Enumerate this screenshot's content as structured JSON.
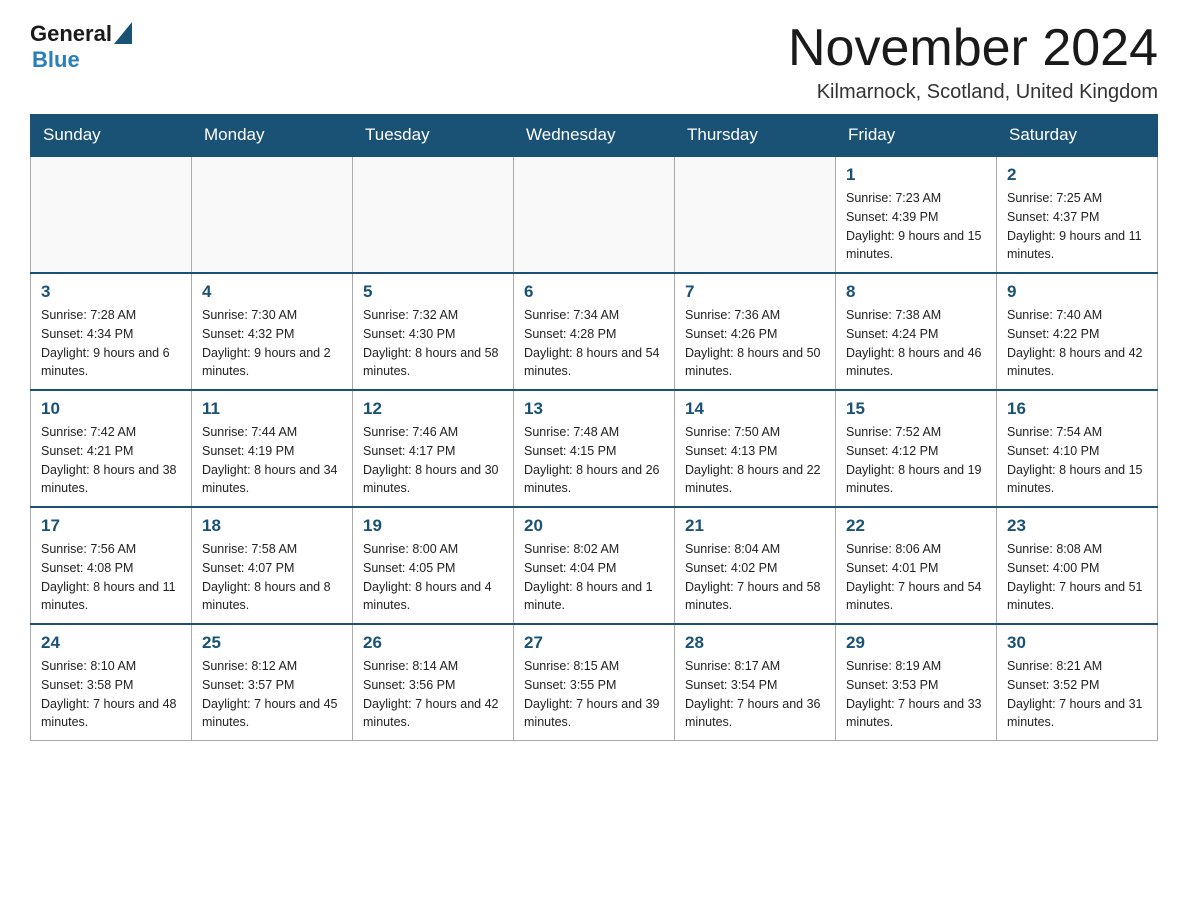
{
  "header": {
    "logo_general": "General",
    "logo_blue": "Blue",
    "month_title": "November 2024",
    "location": "Kilmarnock, Scotland, United Kingdom"
  },
  "weekdays": [
    "Sunday",
    "Monday",
    "Tuesday",
    "Wednesday",
    "Thursday",
    "Friday",
    "Saturday"
  ],
  "weeks": [
    [
      {
        "day": "",
        "info": ""
      },
      {
        "day": "",
        "info": ""
      },
      {
        "day": "",
        "info": ""
      },
      {
        "day": "",
        "info": ""
      },
      {
        "day": "",
        "info": ""
      },
      {
        "day": "1",
        "info": "Sunrise: 7:23 AM\nSunset: 4:39 PM\nDaylight: 9 hours and 15 minutes."
      },
      {
        "day": "2",
        "info": "Sunrise: 7:25 AM\nSunset: 4:37 PM\nDaylight: 9 hours and 11 minutes."
      }
    ],
    [
      {
        "day": "3",
        "info": "Sunrise: 7:28 AM\nSunset: 4:34 PM\nDaylight: 9 hours and 6 minutes."
      },
      {
        "day": "4",
        "info": "Sunrise: 7:30 AM\nSunset: 4:32 PM\nDaylight: 9 hours and 2 minutes."
      },
      {
        "day": "5",
        "info": "Sunrise: 7:32 AM\nSunset: 4:30 PM\nDaylight: 8 hours and 58 minutes."
      },
      {
        "day": "6",
        "info": "Sunrise: 7:34 AM\nSunset: 4:28 PM\nDaylight: 8 hours and 54 minutes."
      },
      {
        "day": "7",
        "info": "Sunrise: 7:36 AM\nSunset: 4:26 PM\nDaylight: 8 hours and 50 minutes."
      },
      {
        "day": "8",
        "info": "Sunrise: 7:38 AM\nSunset: 4:24 PM\nDaylight: 8 hours and 46 minutes."
      },
      {
        "day": "9",
        "info": "Sunrise: 7:40 AM\nSunset: 4:22 PM\nDaylight: 8 hours and 42 minutes."
      }
    ],
    [
      {
        "day": "10",
        "info": "Sunrise: 7:42 AM\nSunset: 4:21 PM\nDaylight: 8 hours and 38 minutes."
      },
      {
        "day": "11",
        "info": "Sunrise: 7:44 AM\nSunset: 4:19 PM\nDaylight: 8 hours and 34 minutes."
      },
      {
        "day": "12",
        "info": "Sunrise: 7:46 AM\nSunset: 4:17 PM\nDaylight: 8 hours and 30 minutes."
      },
      {
        "day": "13",
        "info": "Sunrise: 7:48 AM\nSunset: 4:15 PM\nDaylight: 8 hours and 26 minutes."
      },
      {
        "day": "14",
        "info": "Sunrise: 7:50 AM\nSunset: 4:13 PM\nDaylight: 8 hours and 22 minutes."
      },
      {
        "day": "15",
        "info": "Sunrise: 7:52 AM\nSunset: 4:12 PM\nDaylight: 8 hours and 19 minutes."
      },
      {
        "day": "16",
        "info": "Sunrise: 7:54 AM\nSunset: 4:10 PM\nDaylight: 8 hours and 15 minutes."
      }
    ],
    [
      {
        "day": "17",
        "info": "Sunrise: 7:56 AM\nSunset: 4:08 PM\nDaylight: 8 hours and 11 minutes."
      },
      {
        "day": "18",
        "info": "Sunrise: 7:58 AM\nSunset: 4:07 PM\nDaylight: 8 hours and 8 minutes."
      },
      {
        "day": "19",
        "info": "Sunrise: 8:00 AM\nSunset: 4:05 PM\nDaylight: 8 hours and 4 minutes."
      },
      {
        "day": "20",
        "info": "Sunrise: 8:02 AM\nSunset: 4:04 PM\nDaylight: 8 hours and 1 minute."
      },
      {
        "day": "21",
        "info": "Sunrise: 8:04 AM\nSunset: 4:02 PM\nDaylight: 7 hours and 58 minutes."
      },
      {
        "day": "22",
        "info": "Sunrise: 8:06 AM\nSunset: 4:01 PM\nDaylight: 7 hours and 54 minutes."
      },
      {
        "day": "23",
        "info": "Sunrise: 8:08 AM\nSunset: 4:00 PM\nDaylight: 7 hours and 51 minutes."
      }
    ],
    [
      {
        "day": "24",
        "info": "Sunrise: 8:10 AM\nSunset: 3:58 PM\nDaylight: 7 hours and 48 minutes."
      },
      {
        "day": "25",
        "info": "Sunrise: 8:12 AM\nSunset: 3:57 PM\nDaylight: 7 hours and 45 minutes."
      },
      {
        "day": "26",
        "info": "Sunrise: 8:14 AM\nSunset: 3:56 PM\nDaylight: 7 hours and 42 minutes."
      },
      {
        "day": "27",
        "info": "Sunrise: 8:15 AM\nSunset: 3:55 PM\nDaylight: 7 hours and 39 minutes."
      },
      {
        "day": "28",
        "info": "Sunrise: 8:17 AM\nSunset: 3:54 PM\nDaylight: 7 hours and 36 minutes."
      },
      {
        "day": "29",
        "info": "Sunrise: 8:19 AM\nSunset: 3:53 PM\nDaylight: 7 hours and 33 minutes."
      },
      {
        "day": "30",
        "info": "Sunrise: 8:21 AM\nSunset: 3:52 PM\nDaylight: 7 hours and 31 minutes."
      }
    ]
  ]
}
